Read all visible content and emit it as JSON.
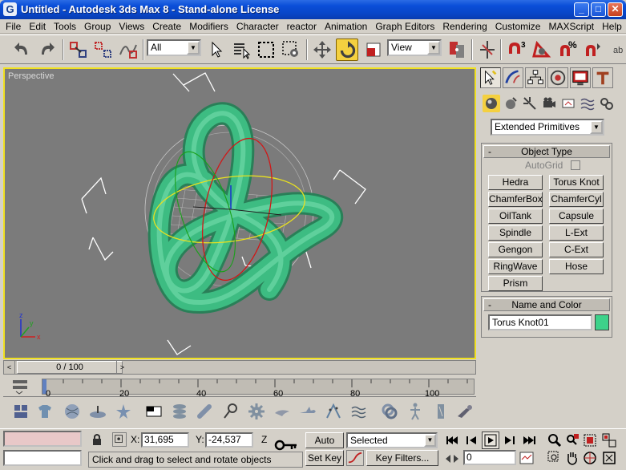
{
  "window": {
    "title": "Untitled - Autodesk 3ds Max 8  - Stand-alone License",
    "app_icon": "G",
    "buttons": {
      "minimize": "_",
      "maximize": "□",
      "close": "✕"
    }
  },
  "menu": [
    "File",
    "Edit",
    "Tools",
    "Group",
    "Views",
    "Create",
    "Modifiers",
    "Character",
    "reactor",
    "Animation",
    "Graph Editors",
    "Rendering",
    "Customize",
    "MAXScript",
    "Help"
  ],
  "toolbar": {
    "selection_filter": "All",
    "reference_coord": "View",
    "snap_label": "3",
    "percent_label": "%"
  },
  "viewport": {
    "label": "Perspective",
    "object_color": "#3dbc82",
    "border_color": "#f0e020",
    "axis_labels": {
      "x": "x",
      "y": "y",
      "z": "z"
    }
  },
  "command_panel": {
    "category": "Extended Primitives",
    "object_type": {
      "header": "Object Type",
      "minus": "-",
      "autogrid": "AutoGrid",
      "buttons": [
        "Hedra",
        "Torus Knot",
        "ChamferBox",
        "ChamferCyl",
        "OilTank",
        "Capsule",
        "Spindle",
        "L-Ext",
        "Gengon",
        "C-Ext",
        "RingWave",
        "Hose",
        "Prism"
      ]
    },
    "name_color": {
      "header": "Name and Color",
      "minus": "-",
      "name": "Torus Knot01",
      "color": "#3dd28a"
    }
  },
  "timeline": {
    "slider": "0 / 100",
    "prev": "<",
    "next": ">",
    "ticks": [
      "0",
      "20",
      "40",
      "60",
      "80",
      "100"
    ]
  },
  "status": {
    "x_label": "X:",
    "x_value": "31,695",
    "y_label": "Y:",
    "y_value": "-24,537",
    "z_label": "Z",
    "auto_key": "Auto Key",
    "set_key": "Set Key",
    "key_mode": "Selected",
    "key_filters": "Key Filters...",
    "frame": "0",
    "prompt": "Click and drag to select and rotate objects"
  }
}
